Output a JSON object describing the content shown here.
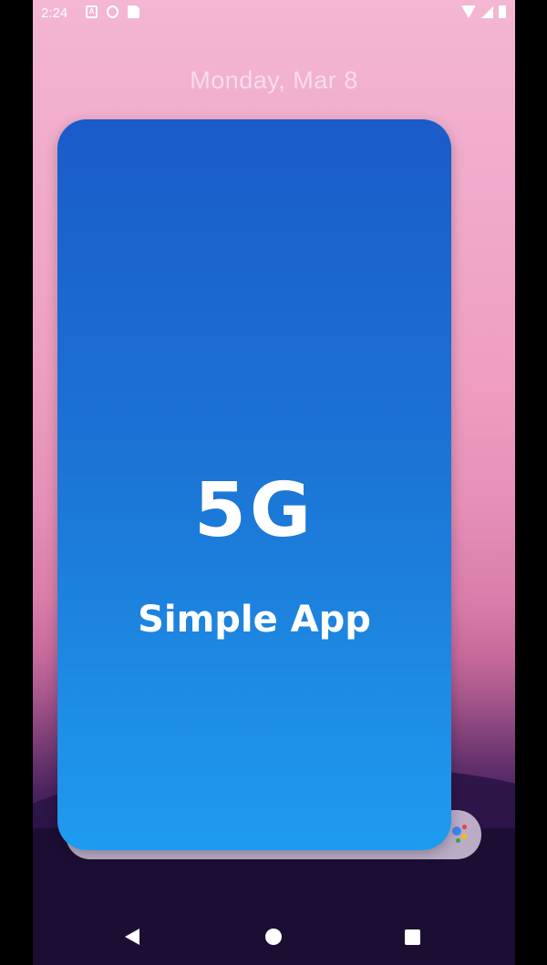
{
  "status_bar": {
    "time": "2:24",
    "left_icons": [
      "text-format-icon",
      "app-notification-icon",
      "sd-card-icon"
    ],
    "right_icons": [
      "wifi-icon",
      "cell-signal-icon",
      "battery-icon"
    ]
  },
  "lock_screen": {
    "date": "Monday, Mar 8"
  },
  "splash": {
    "logo_text": "5G",
    "app_name": "Simple App",
    "gradient_top": "#1a5bc9",
    "gradient_bottom": "#1e9bef"
  },
  "search_widget": {
    "icon": "google-assistant-icon"
  },
  "navigation_bar": {
    "buttons": [
      "back-icon",
      "home-icon",
      "recents-icon"
    ]
  }
}
